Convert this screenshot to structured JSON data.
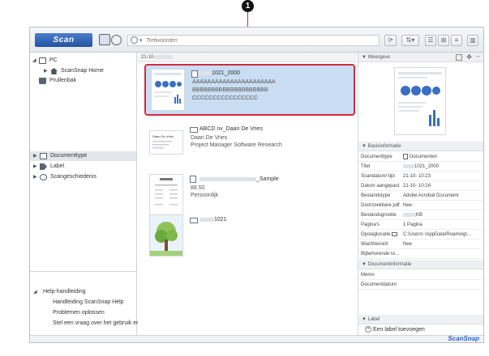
{
  "callout": {
    "number": "1"
  },
  "toolbar": {
    "scan_label": "Scan",
    "search_placeholder": "Trefwoorden"
  },
  "sidebar": {
    "pc": "PC",
    "home": "ScanSnap Home",
    "trash": "Prullenbak",
    "doctype": "Documenttype",
    "label": "Label",
    "history": "Scangeschiedenis",
    "help": "Help-handleiding",
    "help_items": [
      "Handleiding ScanSnap Help",
      "Problemen oplossen",
      "Stel een vraag over het gebruik ervan"
    ]
  },
  "list": {
    "header": "21-10-",
    "items": [
      {
        "title": "1021_2000",
        "lines": [
          "AAAAAAAAAAAAAAAAAAAAAA",
          "BBBBBBBBBBBBBBBBBBBB",
          "CCCCCCCCCCCCCCCC"
        ]
      },
      {
        "title": "ABCD nv_Daan De Vries",
        "lines": [
          "Daan De Vries",
          "Project Manager Software Research"
        ]
      },
      {
        "title": "_Sample",
        "lines": [
          "88.50",
          "Persoonlijk"
        ]
      },
      {
        "title": "1021",
        "lines": []
      }
    ],
    "item2_thumb_text": "Daan De Vries"
  },
  "right": {
    "preview_head": "Weergave",
    "basic_head": "Basisinformatie",
    "props": [
      {
        "k": "Documenttype",
        "v": "Documenten"
      },
      {
        "k": "Titel",
        "v": "1021_2000"
      },
      {
        "k": "Scandatum/-tijd",
        "v": "21-10-         10:23"
      },
      {
        "k": "Datum aangepast",
        "v": "21-10-         10:24"
      },
      {
        "k": "Bestandstype",
        "v": "Adobe Acrobat Document"
      },
      {
        "k": "Doorzoekbare pdf",
        "v": "Nee"
      },
      {
        "k": "Bestandsgrootte",
        "v": "KB"
      },
      {
        "k": "Pagina's",
        "v": "1 Pagina"
      },
      {
        "k": "Opslaglocatie",
        "v": "C:\\Users\\        \\AppData\\Roaming\\..."
      },
      {
        "k": "Wachtwoord",
        "v": "Nee"
      },
      {
        "k": "Bijbehorende to...",
        "v": ""
      }
    ],
    "docinfo_head": "Documentinformatie",
    "docinfo_rows": [
      "Memo",
      "Documentdatum"
    ],
    "label_head": "Label",
    "add_label": "Een label toevoegen"
  },
  "brand": "ScanSnap",
  "colors": {
    "accent": "#23539f",
    "highlight": "#d42a3f",
    "selection": "#c9ddf3"
  }
}
